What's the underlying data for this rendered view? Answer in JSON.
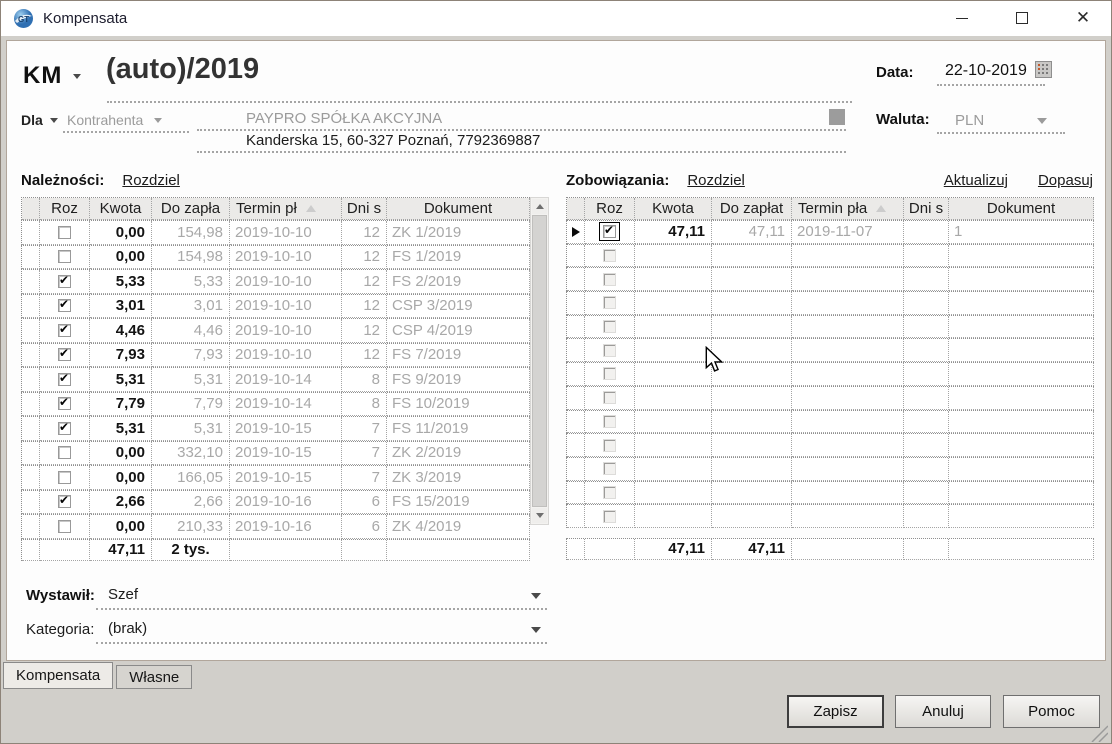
{
  "window": {
    "title": "Kompensata"
  },
  "header": {
    "doc_type": "KM",
    "doc_number": "(auto)/2019",
    "dla_label": "Dla",
    "kontrahent_selector": "Kontrahenta",
    "kontrahent_name": "PAYPRO SPÓŁKA AKCYJNA",
    "kontrahent_address": "Kanderska 15, 60-327 Poznań, 7792369887",
    "data_label": "Data:",
    "data_value": "22-10-2019",
    "waluta_label": "Waluta:",
    "waluta_value": "PLN"
  },
  "naleznosci": {
    "label": "Należności:",
    "link_rozdziel": "Rozdziel",
    "columns": [
      "Roz",
      "Kwota",
      "Do zapła",
      "Termin pł",
      "Dni s",
      "Dokument"
    ],
    "rows": [
      {
        "checked": false,
        "kwota": "0,00",
        "do_zaplaty": "154,98",
        "termin": "2019-10-10",
        "dni": "12",
        "dokument": "ZK 1/2019"
      },
      {
        "checked": false,
        "kwota": "0,00",
        "do_zaplaty": "154,98",
        "termin": "2019-10-10",
        "dni": "12",
        "dokument": "FS 1/2019"
      },
      {
        "checked": true,
        "kwota": "5,33",
        "do_zaplaty": "5,33",
        "termin": "2019-10-10",
        "dni": "12",
        "dokument": "FS 2/2019"
      },
      {
        "checked": true,
        "kwota": "3,01",
        "do_zaplaty": "3,01",
        "termin": "2019-10-10",
        "dni": "12",
        "dokument": "CSP 3/2019"
      },
      {
        "checked": true,
        "kwota": "4,46",
        "do_zaplaty": "4,46",
        "termin": "2019-10-10",
        "dni": "12",
        "dokument": "CSP 4/2019"
      },
      {
        "checked": true,
        "kwota": "7,93",
        "do_zaplaty": "7,93",
        "termin": "2019-10-10",
        "dni": "12",
        "dokument": "FS 7/2019"
      },
      {
        "checked": true,
        "kwota": "5,31",
        "do_zaplaty": "5,31",
        "termin": "2019-10-14",
        "dni": "8",
        "dokument": "FS 9/2019"
      },
      {
        "checked": true,
        "kwota": "7,79",
        "do_zaplaty": "7,79",
        "termin": "2019-10-14",
        "dni": "8",
        "dokument": "FS 10/2019"
      },
      {
        "checked": true,
        "kwota": "5,31",
        "do_zaplaty": "5,31",
        "termin": "2019-10-15",
        "dni": "7",
        "dokument": "FS 11/2019"
      },
      {
        "checked": false,
        "kwota": "0,00",
        "do_zaplaty": "332,10",
        "termin": "2019-10-15",
        "dni": "7",
        "dokument": "ZK 2/2019"
      },
      {
        "checked": false,
        "kwota": "0,00",
        "do_zaplaty": "166,05",
        "termin": "2019-10-15",
        "dni": "7",
        "dokument": "ZK 3/2019"
      },
      {
        "checked": true,
        "kwota": "2,66",
        "do_zaplaty": "2,66",
        "termin": "2019-10-16",
        "dni": "6",
        "dokument": "FS 15/2019"
      },
      {
        "checked": false,
        "kwota": "0,00",
        "do_zaplaty": "210,33",
        "termin": "2019-10-16",
        "dni": "6",
        "dokument": "ZK 4/2019"
      }
    ],
    "summary": {
      "kwota": "47,11",
      "do_zaplaty": "2 tys."
    }
  },
  "zobowiazania": {
    "label": "Zobowiązania:",
    "link_rozdziel": "Rozdziel",
    "link_aktualizuj": "Aktualizuj",
    "link_dopasuj": "Dopasuj",
    "columns": [
      "Roz",
      "Kwota",
      "Do zapłat",
      "Termin pła",
      "Dni s",
      "Dokument"
    ],
    "rows": [
      {
        "checked": true,
        "selected": true,
        "kwota": "47,11",
        "do_zaplaty": "47,11",
        "termin": "2019-11-07",
        "dni": "",
        "dokument": "1"
      }
    ],
    "empty_rows": 12,
    "summary": {
      "kwota": "47,11",
      "do_zaplaty": "47,11"
    }
  },
  "footer": {
    "wystawil_label": "Wystawił:",
    "wystawil_value": "Szef",
    "kategoria_label": "Kategoria:",
    "kategoria_value": "(brak)"
  },
  "tabs": [
    {
      "label": "Kompensata",
      "active": true
    },
    {
      "label": "Własne",
      "active": false
    }
  ],
  "buttons": [
    {
      "label": "Zapisz",
      "default": true
    },
    {
      "label": "Anuluj",
      "default": false
    },
    {
      "label": "Pomoc",
      "default": false
    }
  ],
  "colors": {
    "titlebar_bg": "#ffffff",
    "body_bg": "#d1cfca",
    "disabled_text": "#a8a8a8",
    "link_text": "#1b1b1b",
    "app_icon_blue": "#2f6fb2"
  }
}
